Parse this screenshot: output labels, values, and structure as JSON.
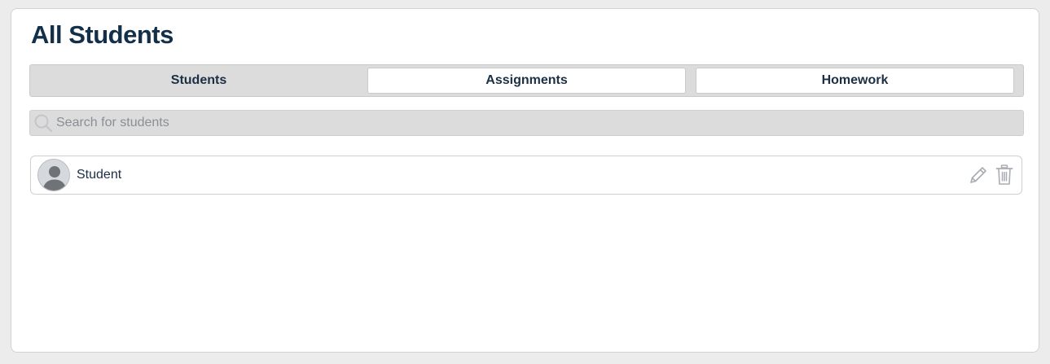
{
  "page": {
    "title": "All Students"
  },
  "tabs": [
    {
      "label": "Students",
      "active": true
    },
    {
      "label": "Assignments",
      "active": false
    },
    {
      "label": "Homework",
      "active": false
    }
  ],
  "search": {
    "placeholder": "Search for students",
    "value": ""
  },
  "students": [
    {
      "name": "Student",
      "avatar_icon": "user-avatar-icon"
    }
  ],
  "icons": {
    "search": "search-icon",
    "edit": "pencil-icon",
    "delete": "trash-icon"
  },
  "colors": {
    "title": "#13304a",
    "tab_bar": "#dcdcdc",
    "icon_gray": "#a9adb2"
  }
}
